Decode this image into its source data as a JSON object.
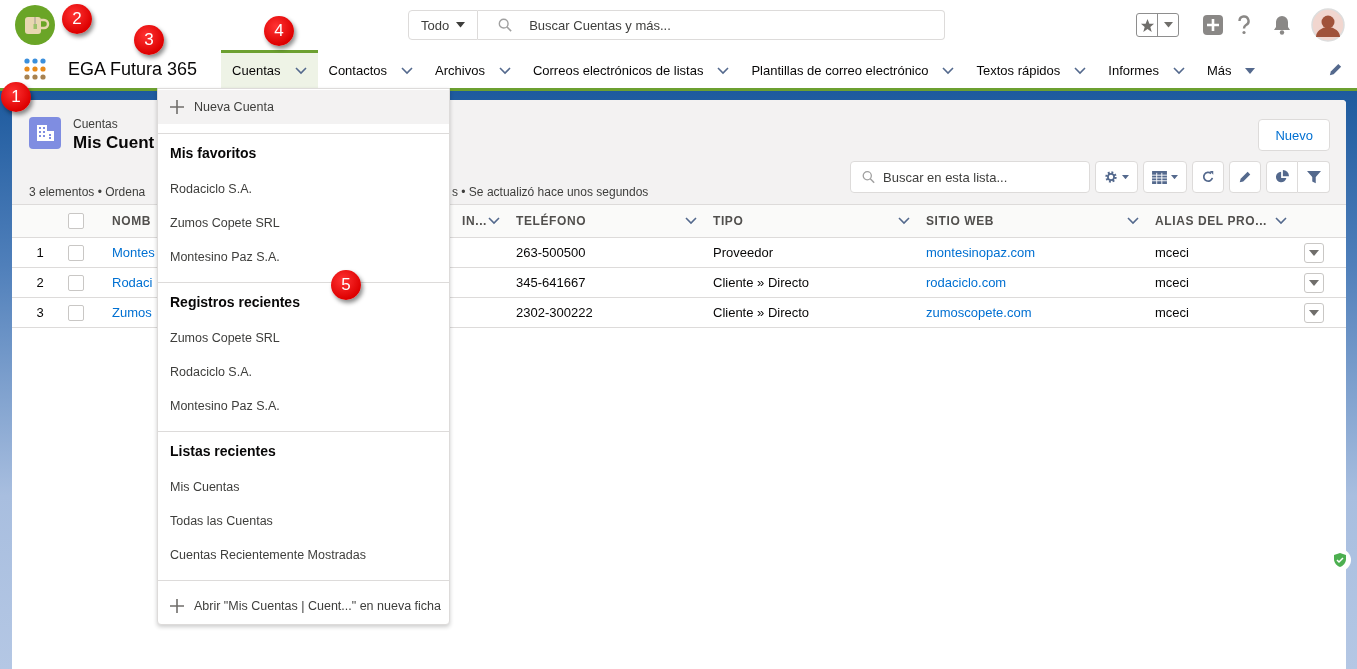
{
  "annotations": [
    "1",
    "2",
    "3",
    "4",
    "5"
  ],
  "header": {
    "scope": "Todo",
    "search_placeholder": "Buscar Cuentas y más..."
  },
  "nav": {
    "app_name": "EGA Futura 365",
    "tabs": [
      {
        "label": "Cuentas",
        "selected": true,
        "kind": "dropdown"
      },
      {
        "label": "Contactos",
        "selected": false,
        "kind": "dropdown"
      },
      {
        "label": "Archivos",
        "selected": false,
        "kind": "dropdown"
      },
      {
        "label": "Correos electrónicos de listas",
        "selected": false,
        "kind": "dropdown"
      },
      {
        "label": "Plantillas de correo electrónico",
        "selected": false,
        "kind": "dropdown"
      },
      {
        "label": "Textos rápidos",
        "selected": false,
        "kind": "dropdown"
      },
      {
        "label": "Informes",
        "selected": false,
        "kind": "dropdown"
      },
      {
        "label": "Más",
        "selected": false,
        "kind": "more"
      }
    ]
  },
  "list_view": {
    "object": "Cuentas",
    "title": "Mis Cuent",
    "meta_left": "3 elementos • Ordena",
    "meta_right": "s • Se actualizó hace unos segundos",
    "new_button": "Nuevo",
    "search_placeholder": "Buscar en esta lista...",
    "all_checked": false,
    "columns": [
      "NOMB",
      "IN...",
      "TELÉFONO",
      "TIPO",
      "SITIO WEB",
      "ALIAS DEL PRO..."
    ],
    "rows": [
      {
        "number": "1",
        "checked": false,
        "name": "Montes",
        "phone": "263-500500",
        "type": "Proveedor",
        "website": "montesinopaz.com",
        "alias": "mceci"
      },
      {
        "number": "2",
        "checked": false,
        "name": "Rodaci",
        "phone": "345-641667",
        "type": "Cliente » Directo",
        "website": "rodaciclo.com",
        "alias": "mceci"
      },
      {
        "number": "3",
        "checked": false,
        "name": "Zumos",
        "phone": "2302-300222",
        "type": "Cliente » Directo",
        "website": "zumoscopete.com",
        "alias": "mceci"
      }
    ]
  },
  "menu": {
    "new_item": "Nueva Cuenta",
    "sections": [
      {
        "title": "Mis favoritos",
        "items": [
          "Rodaciclo S.A.",
          "Zumos Copete SRL",
          "Montesino Paz S.A."
        ]
      },
      {
        "title": "Registros recientes",
        "items": [
          "Zumos Copete SRL",
          "Rodaciclo S.A.",
          "Montesino Paz S.A."
        ]
      },
      {
        "title": "Listas recientes",
        "items": [
          "Mis Cuentas",
          "Todas las Cuentas",
          "Cuentas Recientemente Mostradas"
        ]
      }
    ],
    "footer": "Abrir \"Mis Cuentas | Cuent...\" en nueva ficha"
  }
}
